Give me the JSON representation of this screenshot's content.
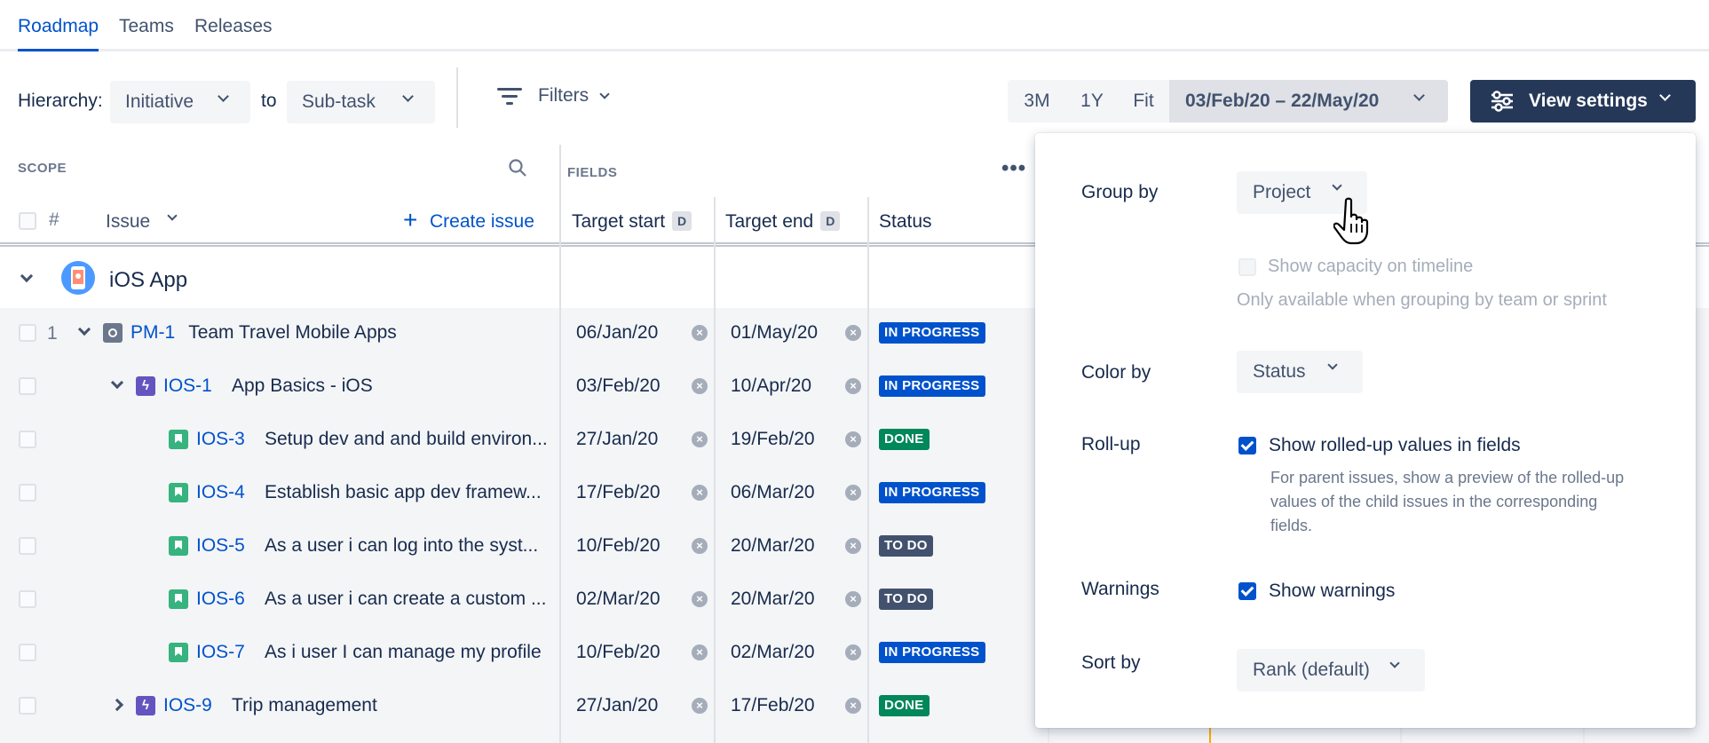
{
  "nav": {
    "tabs": [
      {
        "label": "Roadmap",
        "active": true
      },
      {
        "label": "Teams",
        "active": false
      },
      {
        "label": "Releases",
        "active": false
      }
    ]
  },
  "toolbar": {
    "hierarchy_label": "Hierarchy:",
    "hierarchy_from": "Initiative",
    "to_label": "to",
    "hierarchy_to": "Sub-task",
    "filters_label": "Filters",
    "zoom": [
      "3M",
      "1Y",
      "Fit"
    ],
    "date_range": "03/Feb/20 – 22/May/20",
    "view_settings_label": "View settings"
  },
  "scope": {
    "section_label": "SCOPE",
    "fields_label": "FIELDS",
    "col_hash": "#",
    "col_issue": "Issue",
    "create_issue": "Create issue",
    "col_target_start": "Target start",
    "col_target_end": "Target end",
    "col_status": "Status",
    "date_badge": "D"
  },
  "group": {
    "name": "iOS App"
  },
  "rows": [
    {
      "num": "1",
      "key": "PM-1",
      "title": "Team Travel Mobile Apps",
      "start": "06/Jan/20",
      "end": "01/May/20",
      "status": "IN PROGRESS",
      "type": "initiative",
      "expand": "down"
    },
    {
      "num": "",
      "key": "IOS-1",
      "title": "App Basics - iOS",
      "start": "03/Feb/20",
      "end": "10/Apr/20",
      "status": "IN PROGRESS",
      "type": "epic",
      "expand": "down"
    },
    {
      "num": "",
      "key": "IOS-3",
      "title": "Setup dev and and build environ...",
      "start": "27/Jan/20",
      "end": "19/Feb/20",
      "status": "DONE",
      "type": "story",
      "expand": ""
    },
    {
      "num": "",
      "key": "IOS-4",
      "title": "Establish basic app dev framew...",
      "start": "17/Feb/20",
      "end": "06/Mar/20",
      "status": "IN PROGRESS",
      "type": "story",
      "expand": ""
    },
    {
      "num": "",
      "key": "IOS-5",
      "title": "As a user i can log into the syst...",
      "start": "10/Feb/20",
      "end": "20/Mar/20",
      "status": "TO DO",
      "type": "story",
      "expand": ""
    },
    {
      "num": "",
      "key": "IOS-6",
      "title": "As a user i can create a custom ...",
      "start": "02/Mar/20",
      "end": "20/Mar/20",
      "status": "TO DO",
      "type": "story",
      "expand": ""
    },
    {
      "num": "",
      "key": "IOS-7",
      "title": "As i user I can manage my profile",
      "start": "10/Feb/20",
      "end": "02/Mar/20",
      "status": "IN PROGRESS",
      "type": "story",
      "expand": ""
    },
    {
      "num": "",
      "key": "IOS-9",
      "title": "Trip management",
      "start": "27/Jan/20",
      "end": "17/Feb/20",
      "status": "DONE",
      "type": "epic",
      "expand": "right"
    }
  ],
  "panel": {
    "group_by_label": "Group by",
    "group_by_value": "Project",
    "capacity_label": "Show capacity on timeline",
    "capacity_help": "Only available when grouping by team or sprint",
    "color_by_label": "Color by",
    "color_by_value": "Status",
    "rollup_label": "Roll-up",
    "rollup_checkbox": "Show rolled-up values in fields",
    "rollup_help": "For parent issues, show a preview of the rolled-up values of the child issues in the corresponding fields.",
    "warnings_label": "Warnings",
    "warnings_checkbox": "Show warnings",
    "sort_by_label": "Sort by",
    "sort_by_value": "Rank (default)"
  },
  "colors": {
    "primary": "#0052cc",
    "dark_button": "#253858",
    "in_progress": "#0052cc",
    "done": "#00875a",
    "todo": "#42526e"
  }
}
